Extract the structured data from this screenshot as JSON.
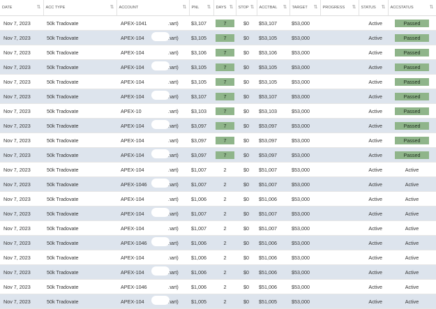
{
  "headers": {
    "date": "DATE",
    "acc_type": "ACC TYPE",
    "account": "ACCOUNT",
    "pnl": "PNL",
    "days": "DAYS",
    "stop": "STOP",
    "acctbal": "ACCTBAL",
    "target": "TARGET",
    "progress": "PROGRESS",
    "status": "STATUS",
    "accstatus": "ACCSTATUS"
  },
  "sort_icon": "sort-arrows-icon",
  "colors": {
    "row_alt": "#dde4ed",
    "passed_badge": "#8fb58a"
  },
  "rows": [
    {
      "date": "Nov 7, 2023",
      "acc_type": "50k Tradovate",
      "account": "APEX-1041",
      "chart": "(chart)",
      "pnl": "$3,107",
      "days": "7",
      "days_badge": true,
      "stop": "$0",
      "acctbal": "$53,107",
      "target": "$53,000",
      "progress": "",
      "status": "Active",
      "accstatus": "Passed",
      "accstatus_badge": true
    },
    {
      "date": "Nov 7, 2023",
      "acc_type": "50k Tradovate",
      "account": "APEX-104",
      "chart": "(chart)",
      "pnl": "$3,105",
      "days": "7",
      "days_badge": true,
      "stop": "$0",
      "acctbal": "$53,105",
      "target": "$53,000",
      "progress": "",
      "status": "Active",
      "accstatus": "Passed",
      "accstatus_badge": true
    },
    {
      "date": "Nov 7, 2023",
      "acc_type": "50k Tradovate",
      "account": "APEX-104",
      "chart": "(chart)",
      "pnl": "$3,106",
      "days": "7",
      "days_badge": true,
      "stop": "$0",
      "acctbal": "$53,106",
      "target": "$53,000",
      "progress": "",
      "status": "Active",
      "accstatus": "Passed",
      "accstatus_badge": true
    },
    {
      "date": "Nov 7, 2023",
      "acc_type": "50k Tradovate",
      "account": "APEX-104",
      "chart": "(chart)",
      "pnl": "$3,105",
      "days": "7",
      "days_badge": true,
      "stop": "$0",
      "acctbal": "$53,105",
      "target": "$53,000",
      "progress": "",
      "status": "Active",
      "accstatus": "Passed",
      "accstatus_badge": true
    },
    {
      "date": "Nov 7, 2023",
      "acc_type": "50k Tradovate",
      "account": "APEX-104",
      "chart": "(chart)",
      "pnl": "$3,105",
      "days": "7",
      "days_badge": true,
      "stop": "$0",
      "acctbal": "$53,105",
      "target": "$53,000",
      "progress": "",
      "status": "Active",
      "accstatus": "Passed",
      "accstatus_badge": true
    },
    {
      "date": "Nov 7, 2023",
      "acc_type": "50k Tradovate",
      "account": "APEX-104",
      "chart": "(chart)",
      "pnl": "$3,107",
      "days": "7",
      "days_badge": true,
      "stop": "$0",
      "acctbal": "$53,107",
      "target": "$53,000",
      "progress": "",
      "status": "Active",
      "accstatus": "Passed",
      "accstatus_badge": true
    },
    {
      "date": "Nov 7, 2023",
      "acc_type": "50k Tradovate",
      "account": "APEX-10",
      "chart": "(chart)",
      "pnl": "$3,103",
      "days": "7",
      "days_badge": true,
      "stop": "$0",
      "acctbal": "$53,103",
      "target": "$53,000",
      "progress": "",
      "status": "Active",
      "accstatus": "Passed",
      "accstatus_badge": true
    },
    {
      "date": "Nov 7, 2023",
      "acc_type": "50k Tradovate",
      "account": "APEX-104",
      "chart": "(chart)",
      "pnl": "$3,097",
      "days": "7",
      "days_badge": true,
      "stop": "$0",
      "acctbal": "$53,097",
      "target": "$53,000",
      "progress": "",
      "status": "Active",
      "accstatus": "Passed",
      "accstatus_badge": true
    },
    {
      "date": "Nov 7, 2023",
      "acc_type": "50k Tradovate",
      "account": "APEX-104",
      "chart": "(chart)",
      "pnl": "$3,097",
      "days": "7",
      "days_badge": true,
      "stop": "$0",
      "acctbal": "$53,097",
      "target": "$53,000",
      "progress": "",
      "status": "Active",
      "accstatus": "Passed",
      "accstatus_badge": true
    },
    {
      "date": "Nov 7, 2023",
      "acc_type": "50k Tradovate",
      "account": "APEX-104",
      "chart": "(chart)",
      "pnl": "$3,097",
      "days": "7",
      "days_badge": true,
      "stop": "$0",
      "acctbal": "$53,097",
      "target": "$53,000",
      "progress": "",
      "status": "Active",
      "accstatus": "Passed",
      "accstatus_badge": true
    },
    {
      "date": "Nov 7, 2023",
      "acc_type": "50k Tradovate",
      "account": "APEX-104",
      "chart": "(chart)",
      "pnl": "$1,007",
      "days": "2",
      "days_badge": false,
      "stop": "$0",
      "acctbal": "$51,007",
      "target": "$53,000",
      "progress": "",
      "status": "Active",
      "accstatus": "Active",
      "accstatus_badge": false
    },
    {
      "date": "Nov 7, 2023",
      "acc_type": "50k Tradovate",
      "account": "APEX-1046",
      "chart": "(chart)",
      "pnl": "$1,007",
      "days": "2",
      "days_badge": false,
      "stop": "$0",
      "acctbal": "$51,007",
      "target": "$53,000",
      "progress": "",
      "status": "Active",
      "accstatus": "Active",
      "accstatus_badge": false
    },
    {
      "date": "Nov 7, 2023",
      "acc_type": "50k Tradovate",
      "account": "APEX-104",
      "chart": "(chart)",
      "pnl": "$1,006",
      "days": "2",
      "days_badge": false,
      "stop": "$0",
      "acctbal": "$51,006",
      "target": "$53,000",
      "progress": "",
      "status": "Active",
      "accstatus": "Active",
      "accstatus_badge": false
    },
    {
      "date": "Nov 7, 2023",
      "acc_type": "50k Tradovate",
      "account": "APEX-104",
      "chart": "(chart)",
      "pnl": "$1,007",
      "days": "2",
      "days_badge": false,
      "stop": "$0",
      "acctbal": "$51,007",
      "target": "$53,000",
      "progress": "",
      "status": "Active",
      "accstatus": "Active",
      "accstatus_badge": false
    },
    {
      "date": "Nov 7, 2023",
      "acc_type": "50k Tradovate",
      "account": "APEX-104",
      "chart": "(chart)",
      "pnl": "$1,007",
      "days": "2",
      "days_badge": false,
      "stop": "$0",
      "acctbal": "$51,007",
      "target": "$53,000",
      "progress": "",
      "status": "Active",
      "accstatus": "Active",
      "accstatus_badge": false
    },
    {
      "date": "Nov 7, 2023",
      "acc_type": "50k Tradovate",
      "account": "APEX-1046",
      "chart": "(chart)",
      "pnl": "$1,006",
      "days": "2",
      "days_badge": false,
      "stop": "$0",
      "acctbal": "$51,006",
      "target": "$53,000",
      "progress": "",
      "status": "Active",
      "accstatus": "Active",
      "accstatus_badge": false
    },
    {
      "date": "Nov 7, 2023",
      "acc_type": "50k Tradovate",
      "account": "APEX-104",
      "chart": "(chart)",
      "pnl": "$1,006",
      "days": "2",
      "days_badge": false,
      "stop": "$0",
      "acctbal": "$51,006",
      "target": "$53,000",
      "progress": "",
      "status": "Active",
      "accstatus": "Active",
      "accstatus_badge": false
    },
    {
      "date": "Nov 7, 2023",
      "acc_type": "50k Tradovate",
      "account": "APEX-104",
      "chart": "(chart)",
      "pnl": "$1,006",
      "days": "2",
      "days_badge": false,
      "stop": "$0",
      "acctbal": "$51,006",
      "target": "$53,000",
      "progress": "",
      "status": "Active",
      "accstatus": "Active",
      "accstatus_badge": false
    },
    {
      "date": "Nov 7, 2023",
      "acc_type": "50k Tradovate",
      "account": "APEX-1046",
      "chart": "(chart)",
      "pnl": "$1,006",
      "days": "2",
      "days_badge": false,
      "stop": "$0",
      "acctbal": "$51,006",
      "target": "$53,000",
      "progress": "",
      "status": "Active",
      "accstatus": "Active",
      "accstatus_badge": false
    },
    {
      "date": "Nov 7, 2023",
      "acc_type": "50k Tradovate",
      "account": "APEX-104",
      "chart": "(chart)",
      "pnl": "$1,005",
      "days": "2",
      "days_badge": false,
      "stop": "$0",
      "acctbal": "$51,005",
      "target": "$53,000",
      "progress": "",
      "status": "Active",
      "accstatus": "Active",
      "accstatus_badge": false
    }
  ]
}
